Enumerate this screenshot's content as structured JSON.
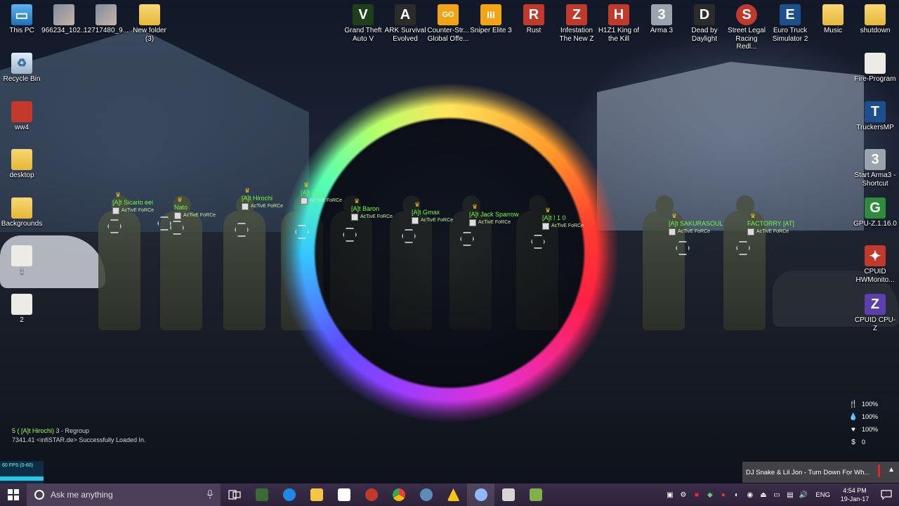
{
  "desktop": {
    "icons": [
      {
        "label": "This PC",
        "glyph": "▭"
      },
      {
        "label": "966234_102...",
        "glyph": ""
      },
      {
        "label": "12717480_9...",
        "glyph": ""
      },
      {
        "label": "New folder\n(3)",
        "glyph": ""
      },
      {
        "label": "Recycle Bin",
        "glyph": "♻"
      },
      {
        "label": "ww4",
        "glyph": ""
      },
      {
        "label": "desktop",
        "glyph": ""
      },
      {
        "label": "Backgrounds",
        "glyph": ""
      },
      {
        "label": "1",
        "glyph": ""
      },
      {
        "label": "2",
        "glyph": ""
      },
      {
        "label": "Grand Theft\nAuto V",
        "glyph": "V"
      },
      {
        "label": "ARK Survival\nEvolved",
        "glyph": "A"
      },
      {
        "label": "Counter-Str...\nGlobal Offe...",
        "glyph": "GO"
      },
      {
        "label": "Sniper Elite 3",
        "glyph": "III"
      },
      {
        "label": "Rust",
        "glyph": "R"
      },
      {
        "label": "Infestation\nThe New Z",
        "glyph": "Z"
      },
      {
        "label": "H1Z1 King of\nthe Kill",
        "glyph": "H"
      },
      {
        "label": "Arma 3",
        "glyph": "3"
      },
      {
        "label": "Dead by\nDaylight",
        "glyph": "D"
      },
      {
        "label": "Street Legal\nRacing Redl...",
        "glyph": "S"
      },
      {
        "label": "Euro Truck\nSimulator 2",
        "glyph": "E"
      },
      {
        "label": "Music",
        "glyph": ""
      },
      {
        "label": "shutdown",
        "glyph": ""
      },
      {
        "label": "Fire-Program",
        "glyph": ""
      },
      {
        "label": "TruckersMP",
        "glyph": "T"
      },
      {
        "label": "Start Arma3 -\nShortcut",
        "glyph": "3"
      },
      {
        "label": "GPU-Z.1.16.0",
        "glyph": "G"
      },
      {
        "label": "CPUID\nHWMonito...",
        "glyph": "✦"
      },
      {
        "label": "CPUID CPU-Z",
        "glyph": "Z"
      }
    ]
  },
  "game": {
    "nametags": [
      {
        "name": "[A]t Sicario eei",
        "org": "AcTivE FoRCe"
      },
      {
        "name": "Nato",
        "org": "AcTivE FoRCe"
      },
      {
        "name": "[A]t Hirochi",
        "org": "AcTivE FoRCe"
      },
      {
        "name": "[A]t Zma",
        "org": "AcTivE FoRCe"
      },
      {
        "name": "[A]t Baron",
        "org": "AcTivE FoRCe"
      },
      {
        "name": "[A]t Gmax",
        "org": "AcTivE FoRCe"
      },
      {
        "name": "[A]t Jack Sparrow",
        "org": "AcTivE FoRCe"
      },
      {
        "name": "[A]t ! 1 0",
        "org": "AcTivE FoRCe"
      },
      {
        "name": "[A]t SAKURASOUL",
        "org": "AcTivE FoRCe"
      },
      {
        "name": "FACTORRY [AT]",
        "org": "AcTivE FoRCe"
      }
    ],
    "log": [
      {
        "prefix": "5 ( [A]t Hirochi)",
        "text": "3 - Regroup"
      },
      {
        "prefix": "7341.41",
        "text": "<infiSTAR.de> Successfully Loaded In."
      }
    ],
    "fps": "60 FPS (0-60)",
    "stats": [
      {
        "icon": "fork-knife-icon",
        "value": "100%"
      },
      {
        "icon": "water-drop-icon",
        "value": "100%"
      },
      {
        "icon": "heart-icon",
        "value": "100%"
      },
      {
        "icon": "money-icon",
        "value": "0"
      }
    ]
  },
  "notification": {
    "text": "DJ Snake & Lil Jon - Turn Down For Wh..."
  },
  "taskbar": {
    "search_placeholder": "Ask me anything",
    "language": "ENG",
    "time": "4:54 PM",
    "date": "19-Jan-17",
    "apps": [
      {
        "name": "task-view",
        "color": "#cccccc"
      },
      {
        "name": "app-green",
        "color": "#3b6b35"
      },
      {
        "name": "edge",
        "color": "#1e88e5"
      },
      {
        "name": "file-explorer",
        "color": "#f4c542"
      },
      {
        "name": "store",
        "color": "#ffffff"
      },
      {
        "name": "app-red",
        "color": "#c0392b"
      },
      {
        "name": "chrome",
        "color": "#34a853"
      },
      {
        "name": "steam",
        "color": "#5b8db8"
      },
      {
        "name": "app-yellow",
        "color": "#f5c518"
      },
      {
        "name": "app-blue",
        "color": "#8fb8ff"
      },
      {
        "name": "app-gray",
        "color": "#d6d6d6"
      },
      {
        "name": "app-stack",
        "color": "#7fb04a"
      }
    ]
  }
}
